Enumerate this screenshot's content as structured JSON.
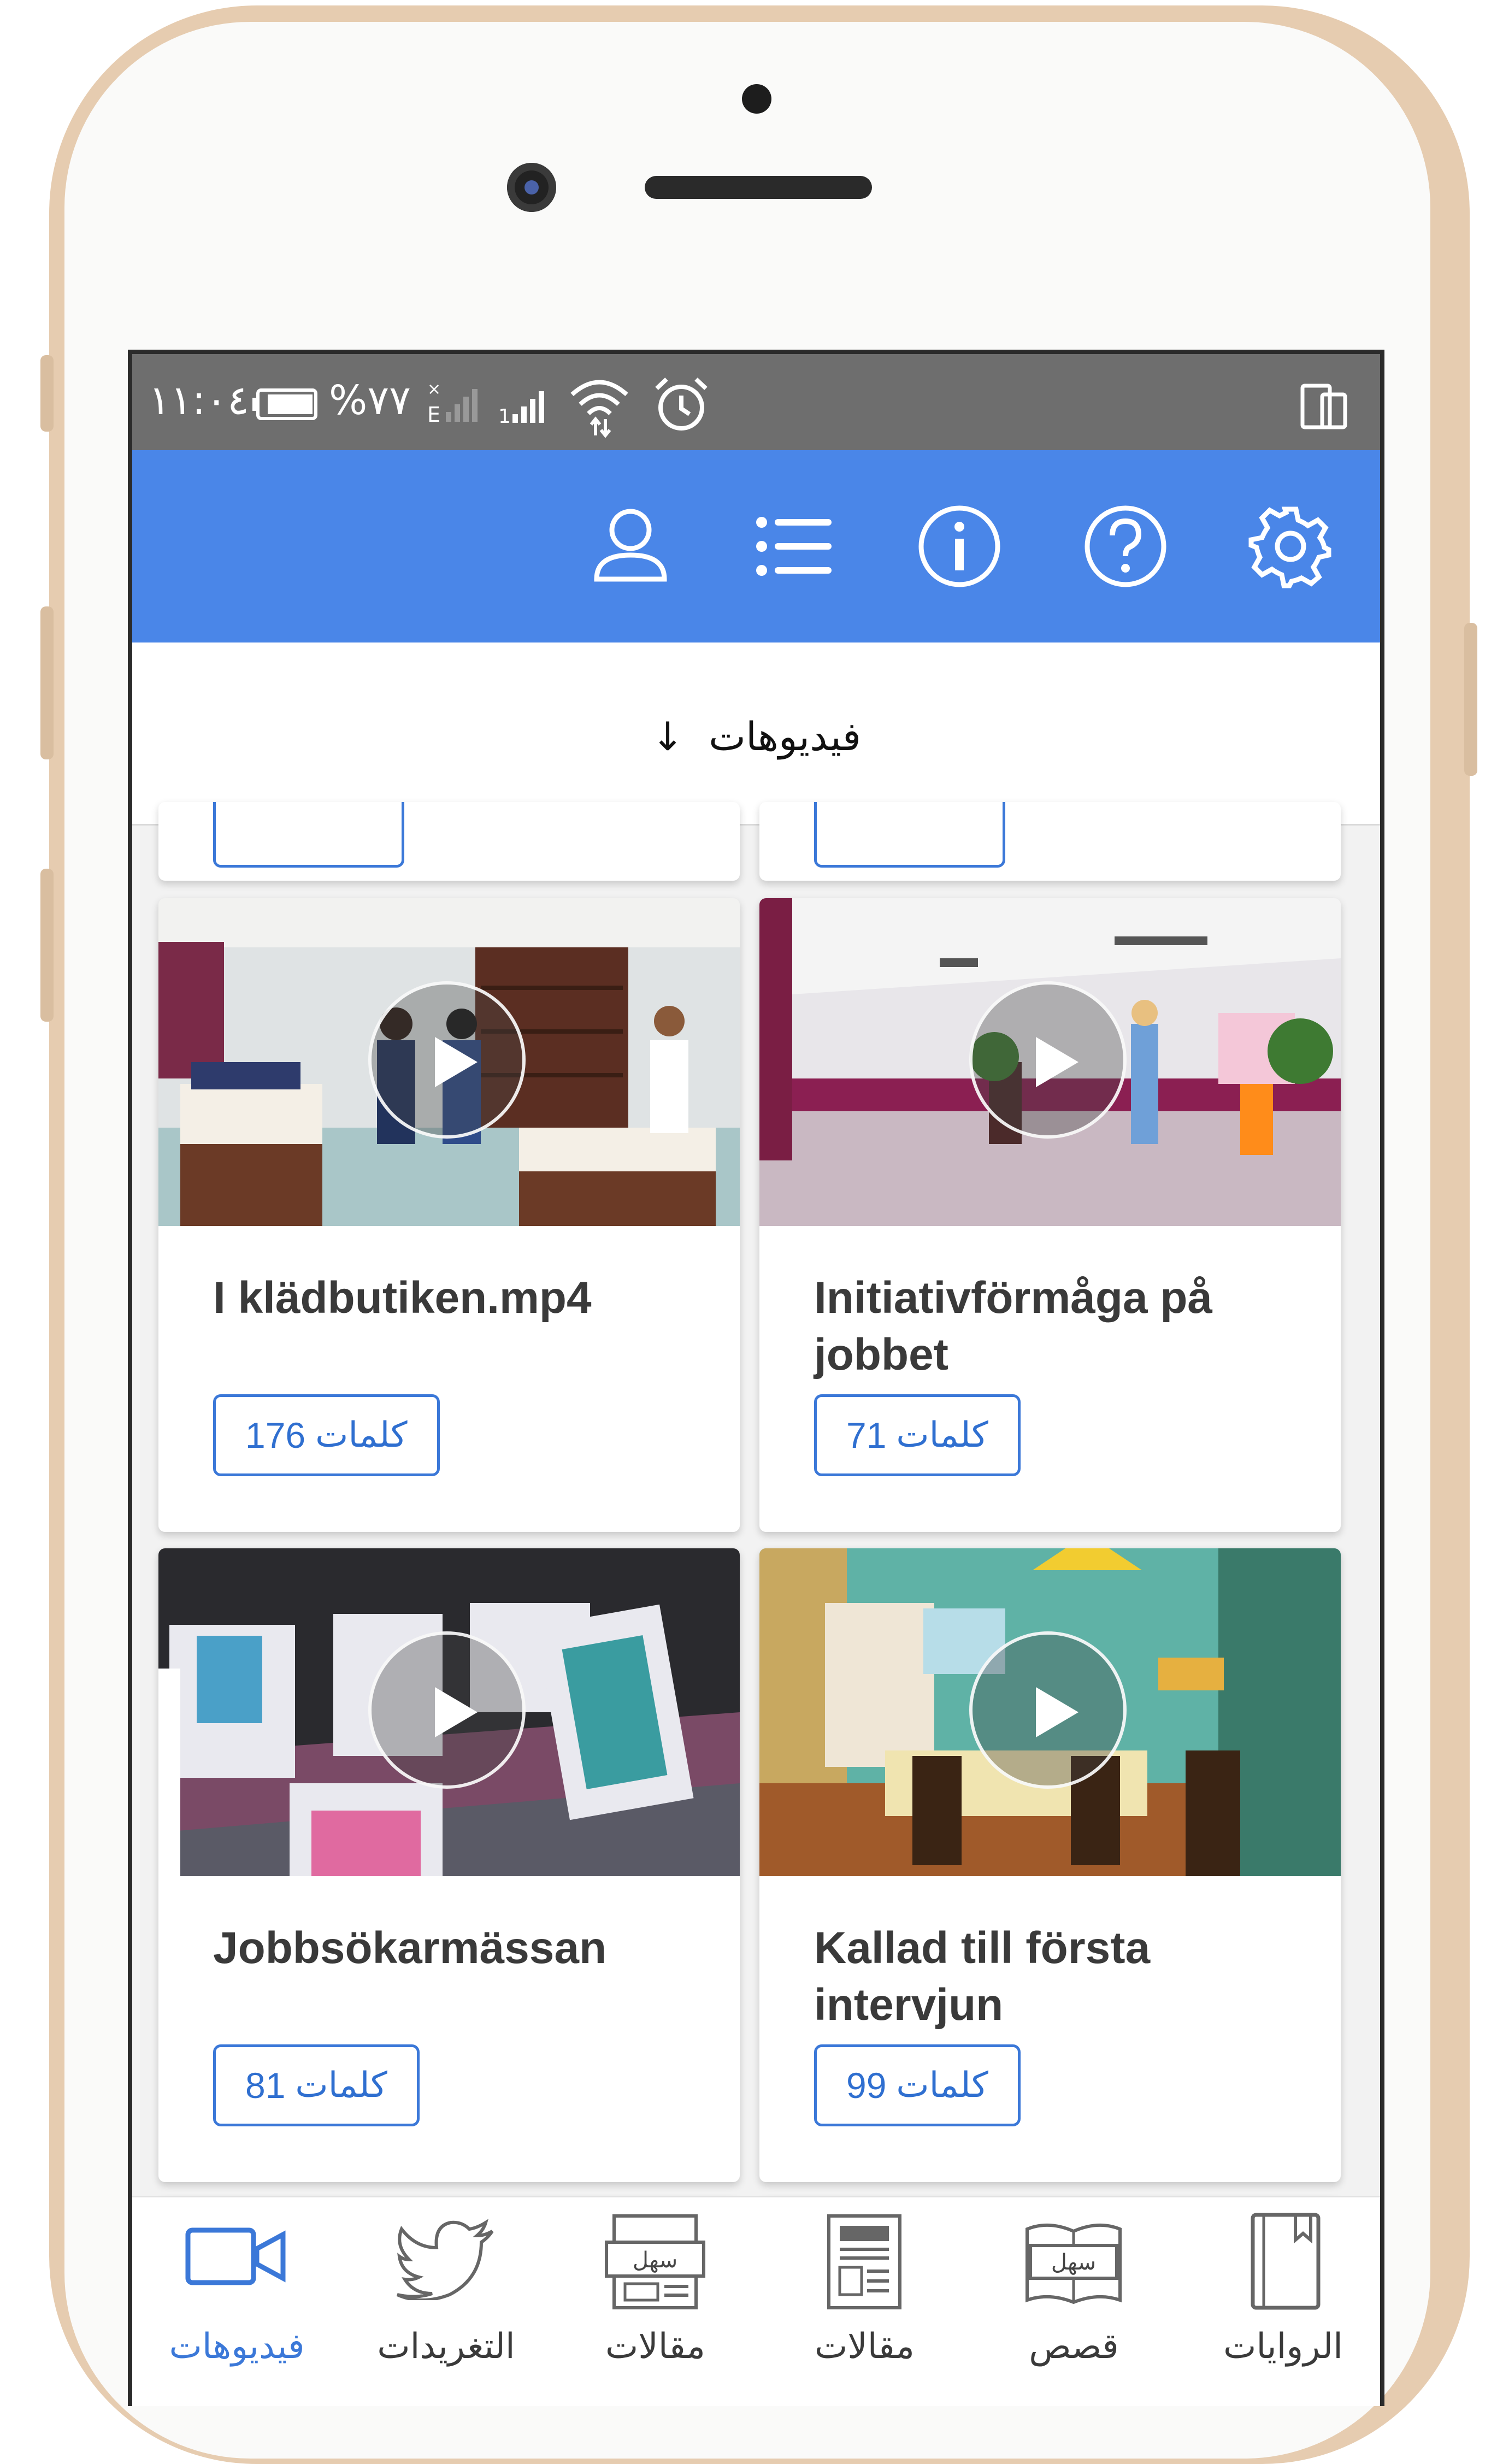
{
  "status_bar": {
    "time": "١١:٠٤",
    "battery": "%٧٧"
  },
  "app_bar": {
    "icons": [
      "profile-icon",
      "list-icon",
      "info-icon",
      "help-icon",
      "settings-icon"
    ]
  },
  "section": {
    "title": "فيديوهات",
    "arrow": "↓"
  },
  "cards": [
    {
      "title": "I klädbutiken.mp4",
      "count": "176",
      "unit": "كلمات"
    },
    {
      "title": "Initiativförmåga på jobbet",
      "count": "71",
      "unit": "كلمات"
    },
    {
      "title": "Jobbsökarmässan",
      "count": "81",
      "unit": "كلمات"
    },
    {
      "title": "Kallad till första intervjun",
      "count": "99",
      "unit": "كلمات"
    }
  ],
  "bottom_nav": [
    {
      "label": "فيديوهات",
      "icon": "video-icon",
      "active": true
    },
    {
      "label": "التغريدات",
      "icon": "twitter-icon",
      "active": false
    },
    {
      "label": "مقالات",
      "icon": "easy-newspaper-icon",
      "active": false
    },
    {
      "label": "مقالات",
      "icon": "newspaper-icon",
      "active": false
    },
    {
      "label": "قصص",
      "icon": "easy-book-icon",
      "active": false
    },
    {
      "label": "الروايات",
      "icon": "bookmark-book-icon",
      "active": false
    }
  ],
  "colors": {
    "accent": "#4a86e8",
    "badge": "#3b78d8",
    "status_bar": "#6e6e6e"
  }
}
